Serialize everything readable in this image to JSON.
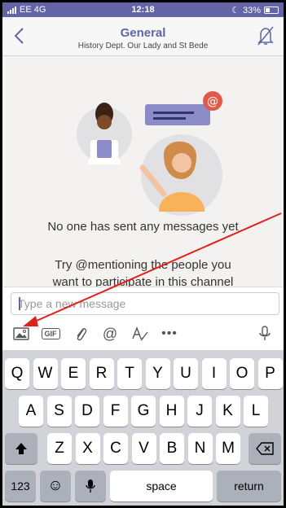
{
  "status": {
    "carrier": "EE 4G",
    "time": "12:18",
    "battery": "33%"
  },
  "header": {
    "title": "General",
    "subtitle": "History Dept. Our Lady and St Bede"
  },
  "chat": {
    "empty_title": "No one has sent any messages yet",
    "hint_line1": "Try @mentioning the people you",
    "hint_line2": "want to participate in this channel"
  },
  "compose": {
    "placeholder": "Type a new message",
    "gif_label": "GIF"
  },
  "keyboard": {
    "row1": [
      "Q",
      "W",
      "E",
      "R",
      "T",
      "Y",
      "U",
      "I",
      "O",
      "P"
    ],
    "row2": [
      "A",
      "S",
      "D",
      "F",
      "G",
      "H",
      "J",
      "K",
      "L"
    ],
    "row3": [
      "Z",
      "X",
      "C",
      "V",
      "B",
      "N",
      "M"
    ],
    "numbers_label": "123",
    "space_label": "space",
    "return_label": "return"
  },
  "colors": {
    "brand": "#6264a7",
    "annotation": "#e0201b"
  },
  "icons": [
    "back-chevron-icon",
    "bell-off-icon",
    "image-icon",
    "gif-icon",
    "attach-icon",
    "mention-icon",
    "format-icon",
    "more-icon",
    "mic-icon",
    "shift-icon",
    "backspace-icon",
    "emoji-icon"
  ]
}
